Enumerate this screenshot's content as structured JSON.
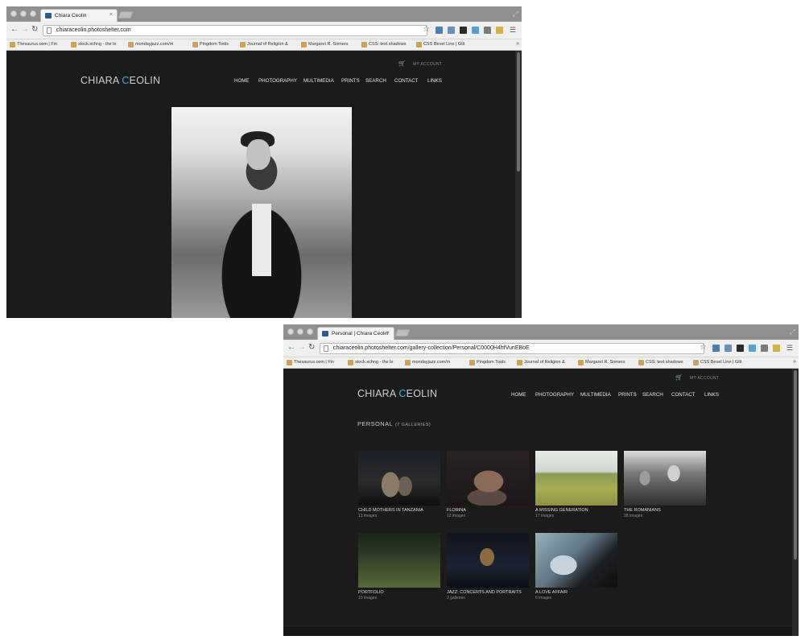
{
  "window1": {
    "tab_title": "Chiara Ceolin",
    "url": "chiaraceolin.photoshelter.com",
    "site": {
      "account_link": "MY ACCOUNT",
      "logo_text": "CHIARA ",
      "logo_accent": "C",
      "logo_rest": "EOLIN",
      "nav": [
        "HOME",
        "PHOTOGRAPHY",
        "MULTIMEDIA",
        "PRINTS",
        "SEARCH",
        "CONTACT",
        "LINKS"
      ]
    }
  },
  "window2": {
    "tab_title": "Personal | Chiara Ceolin",
    "url": "chiaraceolin.photoshelter.com/gallery-collection/Personal/C0000H4hfVunEBoE",
    "site": {
      "account_link": "MY ACCOUNT",
      "logo_text": "CHIARA ",
      "logo_accent": "C",
      "logo_rest": "EOLIN",
      "nav": [
        "HOME",
        "PHOTOGRAPHY",
        "MULTIMEDIA",
        "PRINTS",
        "SEARCH",
        "CONTACT",
        "LINKS"
      ],
      "section_title": "PERSONAL",
      "section_count": "(7 GALLERIES)",
      "galleries": [
        {
          "title": "CHILD MOTHERS IN TANZANIA",
          "count": "13 images"
        },
        {
          "title": "FLORINA",
          "count": "12 images"
        },
        {
          "title": "A MISSING GENERATION",
          "count": "17 images"
        },
        {
          "title": "THE ROMANIANS",
          "count": "38 images"
        },
        {
          "title": "PORTFOLIO",
          "count": "10 images"
        },
        {
          "title": "JAZZ: CONCERTS AND PORTRAITS",
          "count": "3 galleries"
        },
        {
          "title": "A LOVE AFFAIR",
          "count": "6 images"
        }
      ]
    }
  },
  "bookmarks_w1": [
    "Thesaurus.com | Fin",
    "stock.xchng - the le",
    "mondayjazz.com/m",
    "Pingdom Tools",
    "Journal of Religion &",
    "Margaret R. Somers",
    "CSS: text shadows",
    "CSS Bevel Line | Gilt"
  ],
  "bookmarks_w2": [
    "Thesaurus.com | Fin",
    "stock.xchng - the le",
    "mondayjazz.com/m",
    "Pingdom Tools",
    "Journal of Religion &",
    "Margaret R. Somers",
    "CSS: text shadows",
    "CSS Bevel Line | Gilt"
  ],
  "icons": {
    "close": "×",
    "back": "←",
    "forward": "→",
    "reload": "↻",
    "star": "☆",
    "menu": "☰",
    "cart": "🛒",
    "more": "»",
    "resize": "⤢"
  },
  "colors": {
    "site_bg": "#1b1b1b",
    "logo_accent": "#3fb0d6"
  }
}
